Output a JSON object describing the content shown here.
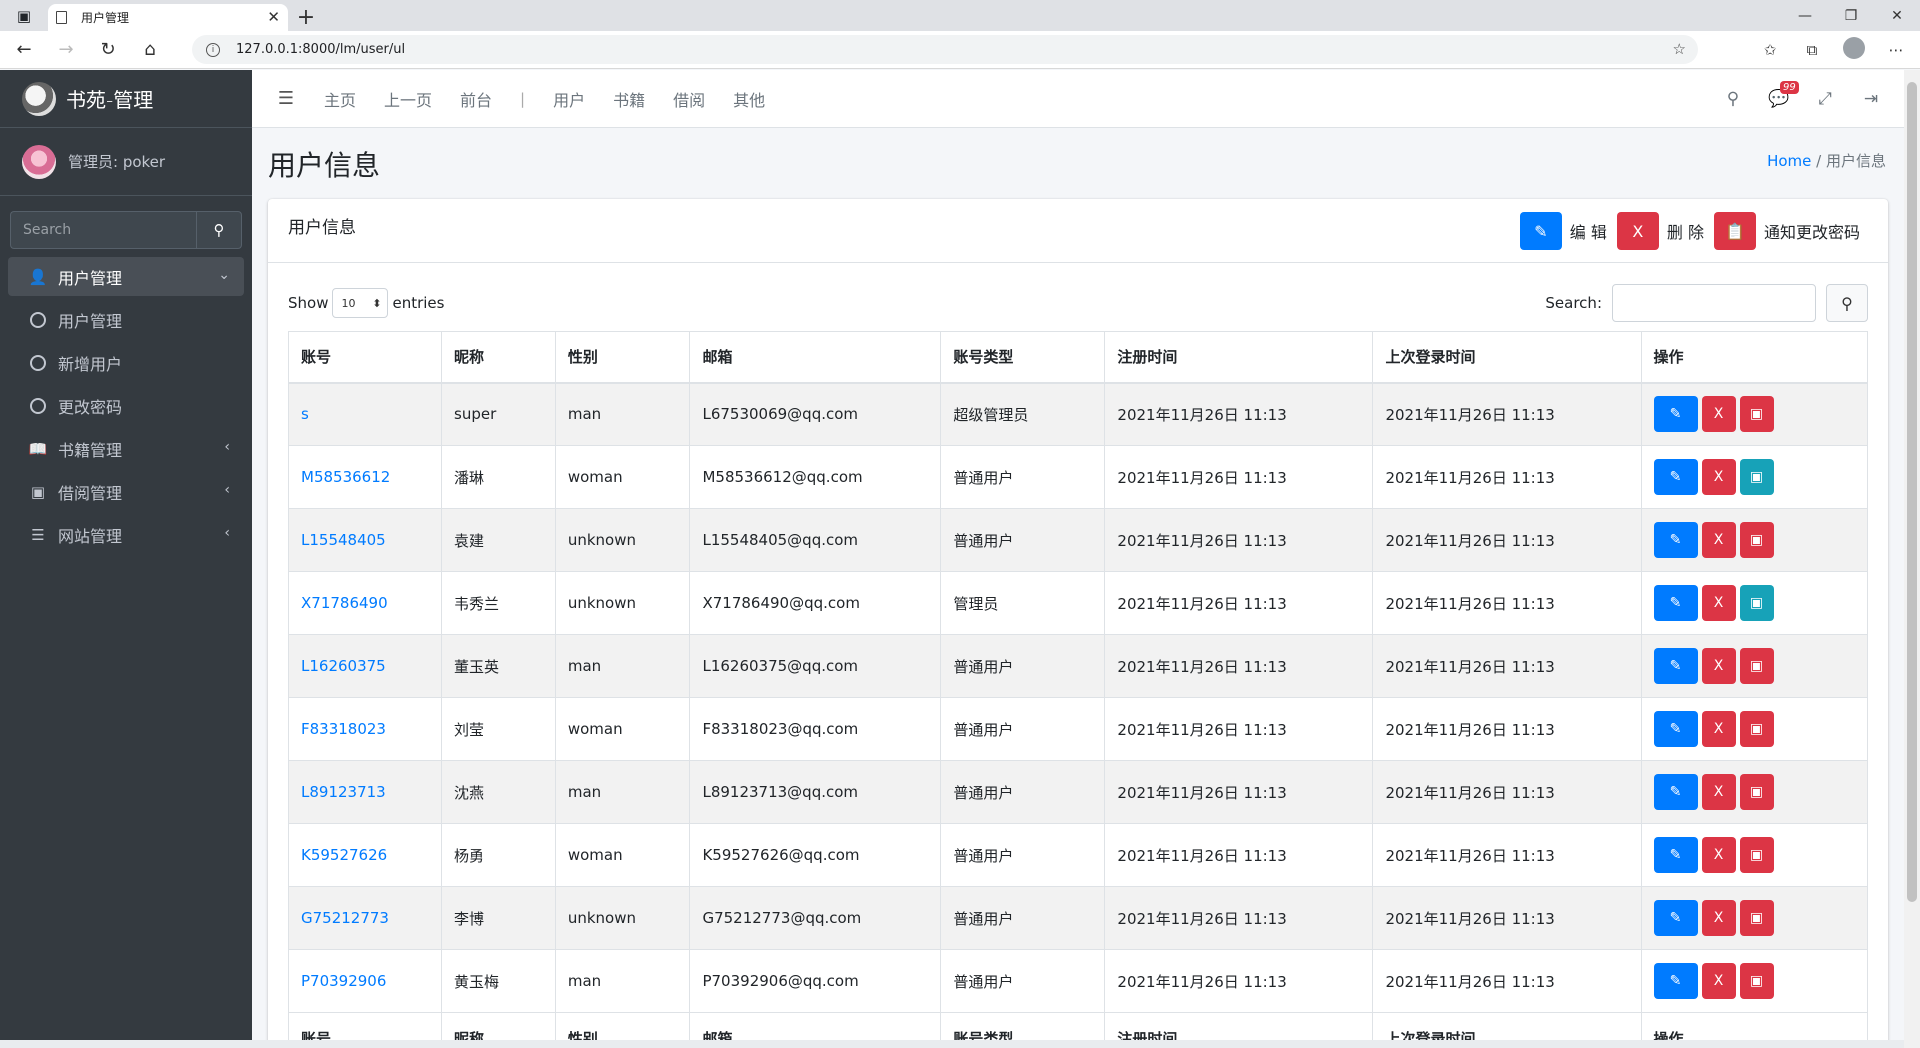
{
  "browser": {
    "tab_title": "用户管理",
    "url": "127.0.0.1:8000/lm/user/ul"
  },
  "sidebar": {
    "brand": "书苑-管理",
    "user": "管理员: poker",
    "search_placeholder": "Search",
    "items": [
      {
        "label": "用户管理",
        "icon": "user-icon",
        "active": true,
        "arrow": "chevron-down-icon"
      },
      {
        "label": "用户管理",
        "icon": "circle-icon"
      },
      {
        "label": "新增用户",
        "icon": "circle-icon"
      },
      {
        "label": "更改密码",
        "icon": "circle-icon"
      },
      {
        "label": "书籍管理",
        "icon": "book-icon",
        "arrow": "chevron-left-icon"
      },
      {
        "label": "借阅管理",
        "icon": "reader-icon",
        "arrow": "chevron-left-icon"
      },
      {
        "label": "网站管理",
        "icon": "list-icon",
        "arrow": "chevron-left-icon"
      }
    ]
  },
  "topnav": {
    "links": [
      "主页",
      "上一页",
      "前台",
      "用户",
      "书籍",
      "借阅",
      "其他"
    ],
    "separator": "|",
    "badge": "99"
  },
  "header": {
    "title": "用户信息",
    "breadcrumb_home": "Home",
    "breadcrumb_sep": "/",
    "breadcrumb_current": "用户信息"
  },
  "card": {
    "title": "用户信息",
    "edit_label": "编 辑",
    "delete_label": "删 除",
    "notify_label": "通知更改密码",
    "delete_btn_text": "X"
  },
  "datatable": {
    "show_label": "Show",
    "entries_value": "10",
    "entries_label": "entries",
    "search_label": "Search:"
  },
  "table": {
    "headers": [
      "账号",
      "昵称",
      "性别",
      "邮箱",
      "账号类型",
      "注册时间",
      "上次登录时间",
      "操作"
    ],
    "rows": [
      {
        "account": "s",
        "nick": "super",
        "gender": "man",
        "email": "L67530069@qq.com",
        "type": "超级管理员",
        "reg": "2021年11月26日 11:13",
        "last": "2021年11月26日 11:13",
        "notify_color": "red"
      },
      {
        "account": "M58536612",
        "nick": "潘琳",
        "gender": "woman",
        "email": "M58536612@qq.com",
        "type": "普通用户",
        "reg": "2021年11月26日 11:13",
        "last": "2021年11月26日 11:13",
        "notify_color": "teal"
      },
      {
        "account": "L15548405",
        "nick": "袁建",
        "gender": "unknown",
        "email": "L15548405@qq.com",
        "type": "普通用户",
        "reg": "2021年11月26日 11:13",
        "last": "2021年11月26日 11:13",
        "notify_color": "red"
      },
      {
        "account": "X71786490",
        "nick": "韦秀兰",
        "gender": "unknown",
        "email": "X71786490@qq.com",
        "type": "管理员",
        "reg": "2021年11月26日 11:13",
        "last": "2021年11月26日 11:13",
        "notify_color": "teal"
      },
      {
        "account": "L16260375",
        "nick": "董玉英",
        "gender": "man",
        "email": "L16260375@qq.com",
        "type": "普通用户",
        "reg": "2021年11月26日 11:13",
        "last": "2021年11月26日 11:13",
        "notify_color": "red"
      },
      {
        "account": "F83318023",
        "nick": "刘莹",
        "gender": "woman",
        "email": "F83318023@qq.com",
        "type": "普通用户",
        "reg": "2021年11月26日 11:13",
        "last": "2021年11月26日 11:13",
        "notify_color": "red"
      },
      {
        "account": "L89123713",
        "nick": "沈燕",
        "gender": "man",
        "email": "L89123713@qq.com",
        "type": "普通用户",
        "reg": "2021年11月26日 11:13",
        "last": "2021年11月26日 11:13",
        "notify_color": "red"
      },
      {
        "account": "K59527626",
        "nick": "杨勇",
        "gender": "woman",
        "email": "K59527626@qq.com",
        "type": "普通用户",
        "reg": "2021年11月26日 11:13",
        "last": "2021年11月26日 11:13",
        "notify_color": "red"
      },
      {
        "account": "G75212773",
        "nick": "李博",
        "gender": "unknown",
        "email": "G75212773@qq.com",
        "type": "普通用户",
        "reg": "2021年11月26日 11:13",
        "last": "2021年11月26日 11:13",
        "notify_color": "red"
      },
      {
        "account": "P70392906",
        "nick": "黄玉梅",
        "gender": "man",
        "email": "P70392906@qq.com",
        "type": "普通用户",
        "reg": "2021年11月26日 11:13",
        "last": "2021年11月26日 11:13",
        "notify_color": "red"
      }
    ]
  },
  "colors": {
    "primary": "#007bff",
    "danger": "#dc3545",
    "info": "#17a2b8",
    "sidebar_bg": "#343a40"
  }
}
